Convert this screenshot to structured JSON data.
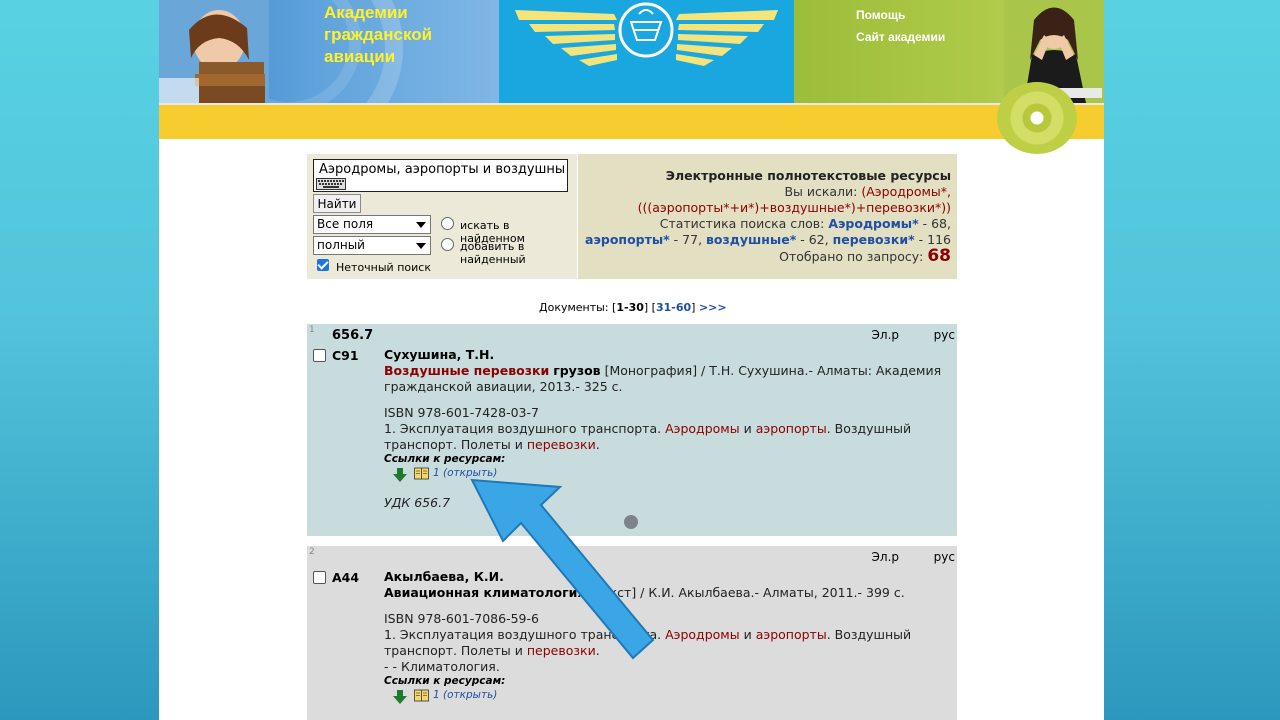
{
  "header": {
    "title_lines": [
      "Академии",
      "гражданской",
      "авиации"
    ],
    "links": {
      "help": "Помощь",
      "site": "Сайт академии"
    }
  },
  "search": {
    "query": "Аэродромы, аэропорты и воздушны",
    "button": "Найти",
    "field_select": "Все поля",
    "mode_select": "полный",
    "radio_search_in_found": "искать в найденном",
    "radio_add_to_found": "добавить в найденный",
    "fuzzy_search_label": "Неточный поиск",
    "fuzzy_checked": true
  },
  "results_info": {
    "title": "Электронные полнотекстовые ресурсы",
    "searched_prefix": "Вы искали:",
    "query_line1": "(Аэродромы*,",
    "query_line2": "(((аэропорты*+и*)+воздушные*)+перевозки*))",
    "stats_prefix": "Статистика поиска слов:",
    "words": [
      {
        "word": "Аэродромы*",
        "count": "68"
      },
      {
        "word": "аэропорты*",
        "count": "77"
      },
      {
        "word": "воздушные*",
        "count": "62"
      },
      {
        "word": "перевозки*",
        "count": "116"
      }
    ],
    "selected_label": "Отобрано по запросу:",
    "selected_count": "68"
  },
  "pagination": {
    "label": "Документы:",
    "current": "1-30",
    "next": "31-60",
    "more": ">>>"
  },
  "records": [
    {
      "num": "1",
      "udc": "656.7",
      "type": "Эл.р",
      "lang": "рус",
      "code": "С91",
      "author": "Сухушина, Т.Н.",
      "title_hl": "Воздушные перевозки",
      "title_rest": "грузов",
      "desc": "[Монография] / Т.Н. Сухушина.- Алматы: Академия гражданской авиации, 2013.- 325 с.",
      "isbn": "ISBN 978-601-7428-03-7",
      "subject_prefix": "1. Эксплуатация воздушного транспорта.",
      "subject_hl1": "Аэродромы",
      "subject_and": "и",
      "subject_hl2": "аэропорты",
      "subject_mid": ". Воздушный транспорт. Полеты и",
      "subject_hl3": "перевозки",
      "subject_end": ".",
      "links_label": "Ссылки к ресурсам:",
      "open_link": "1 (открыть)",
      "udk": "УДК 656.7"
    },
    {
      "num": "2",
      "type": "Эл.р",
      "lang": "рус",
      "code": "А44",
      "author": "Акылбаева, К.И.",
      "title_bold": "Авиационная климатология",
      "desc": "[Текст] / К.И. Акылбаева.- Алматы, 2011.- 399 с.",
      "isbn": "ISBN 978-601-7086-59-6",
      "subject_prefix": "1. Эксплуатация воздушного транспорта.",
      "subject_hl1": "Аэродромы",
      "subject_and": "и",
      "subject_hl2": "аэропорты",
      "subject_mid": ". Воздушный транспорт. Полеты и",
      "subject_hl3": "перевозки",
      "subject_end": ".",
      "extra": "- - Климатология.",
      "links_label": "Ссылки к ресурсам:",
      "open_link": "1 (открыть)"
    }
  ],
  "colors": {
    "highlight": "#8b0000",
    "link": "#1f4fa3",
    "record1_bg": "#c9dcdd",
    "record2_bg": "#dcdcdc",
    "arrow": "#3aa6e6"
  }
}
